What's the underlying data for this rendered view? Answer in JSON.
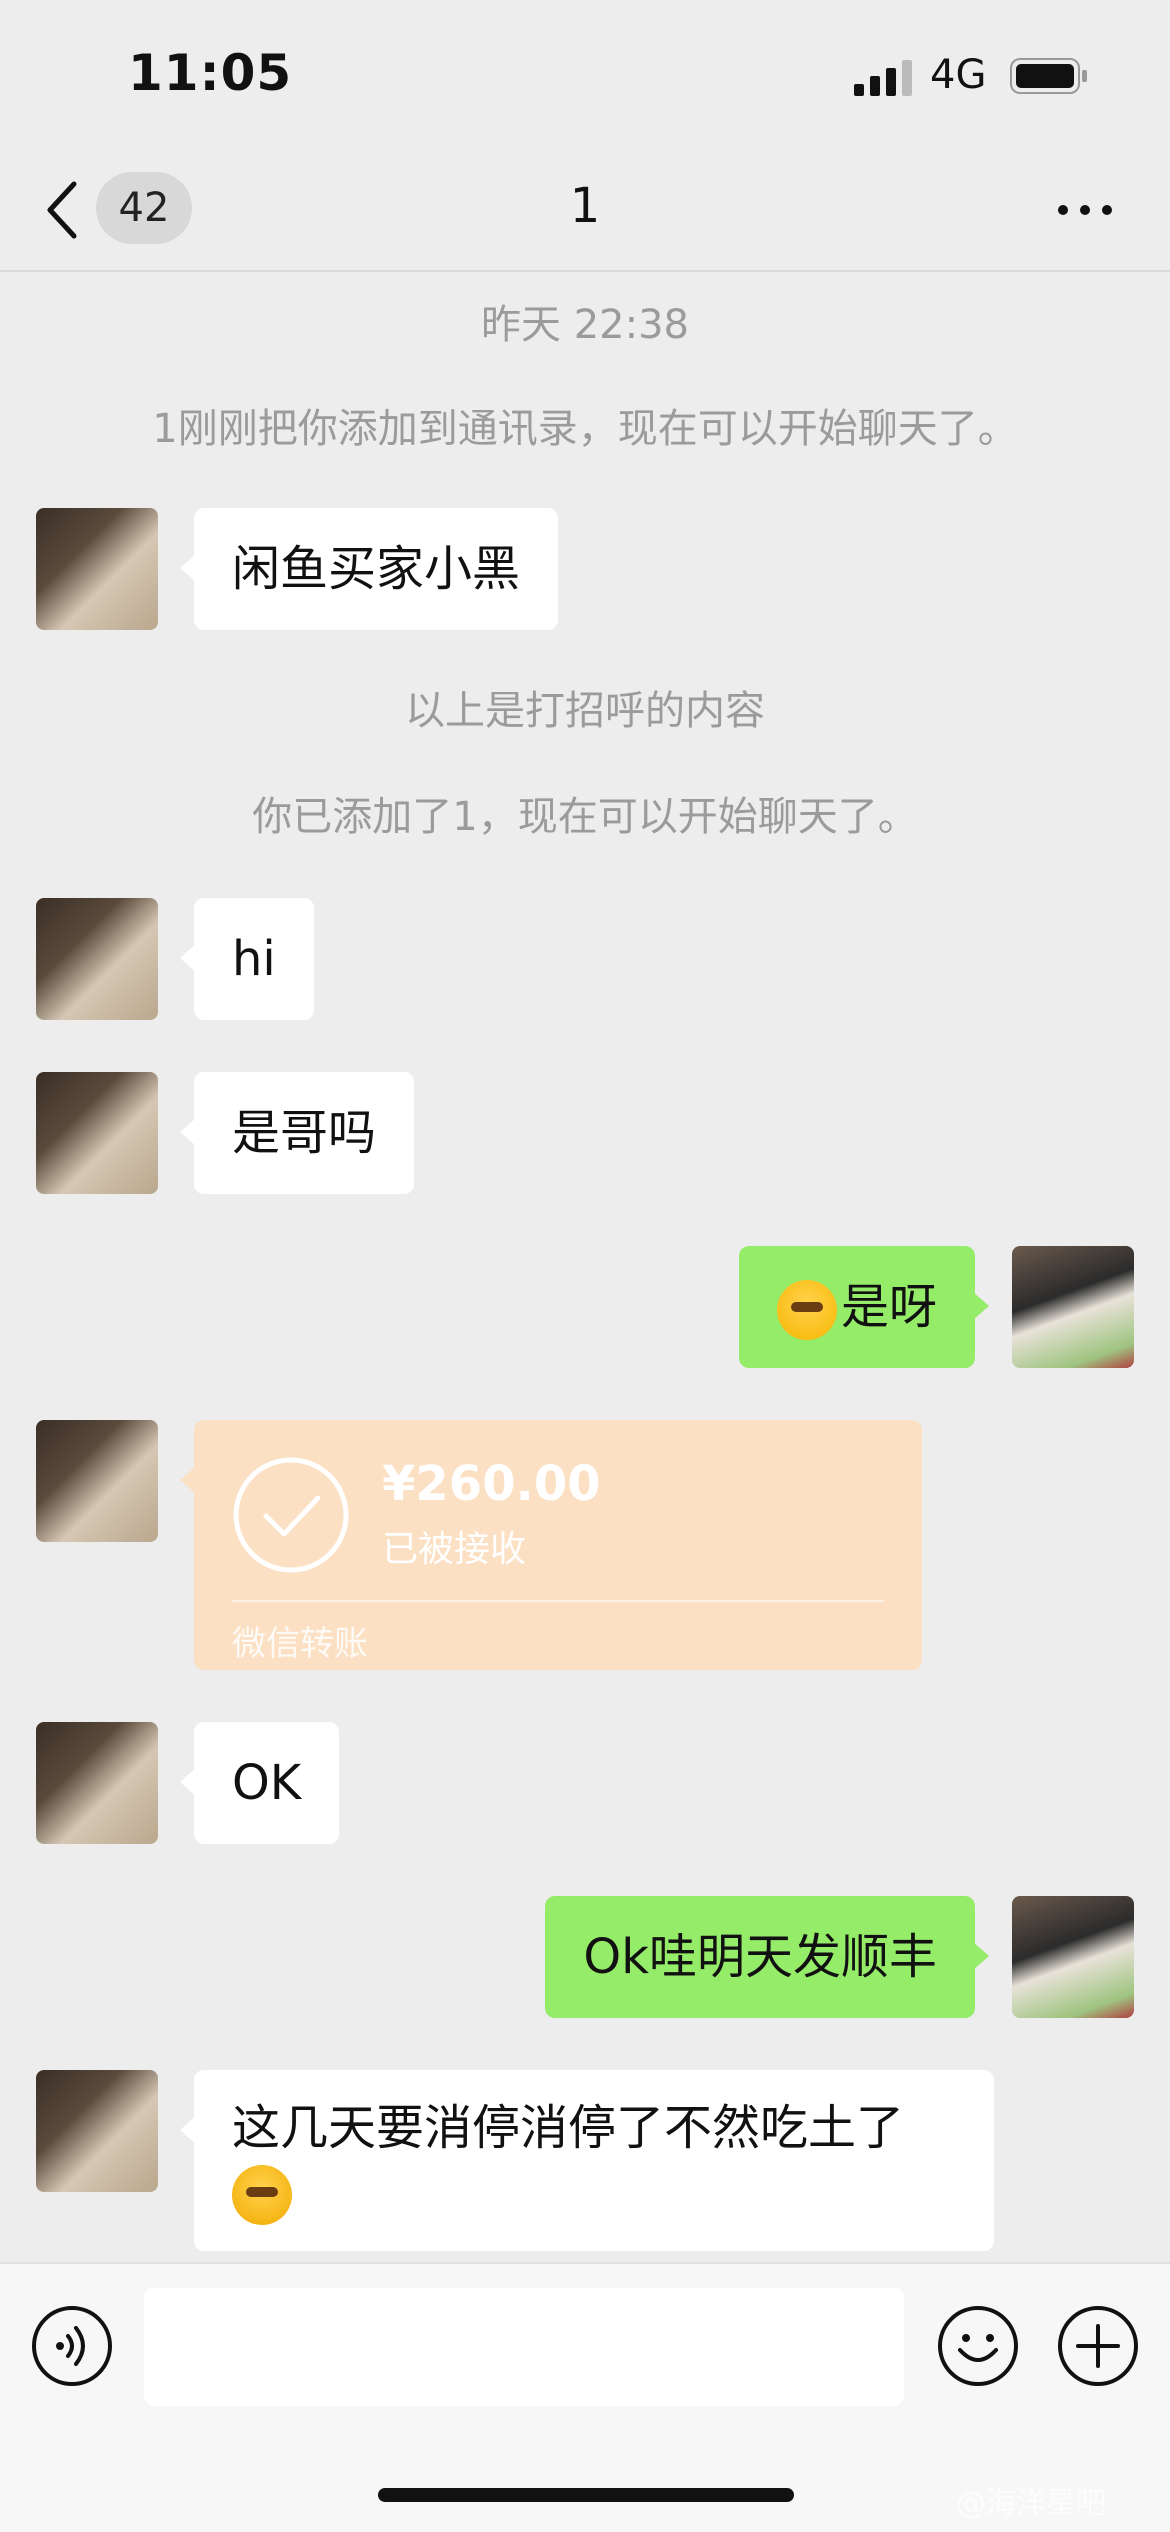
{
  "status_bar": {
    "time": "11:05",
    "network": "4G"
  },
  "nav": {
    "unread_count": "42",
    "title": "1"
  },
  "system": {
    "timestamp": "昨天 22:38",
    "added_notice": "1刚刚把你添加到通讯录，现在可以开始聊天了。",
    "greeting_notice": "以上是打招呼的内容",
    "you_added_notice": "你已添加了1，现在可以开始聊天了。"
  },
  "messages": [
    {
      "from": "contact",
      "text": "闲鱼买家小黑"
    },
    {
      "from": "contact",
      "text": "hi"
    },
    {
      "from": "contact",
      "text": "是哥吗"
    },
    {
      "from": "me",
      "emoji": "drooling-face-emoji",
      "text": "是呀"
    },
    {
      "from": "contact",
      "type": "transfer",
      "amount": "¥260.00",
      "status": "已被接收",
      "label": "微信转账"
    },
    {
      "from": "contact",
      "text": "OK"
    },
    {
      "from": "me",
      "text": "Ok哇明天发顺丰"
    },
    {
      "from": "contact",
      "text": "这几天要消停消停了不然吃土了",
      "emoji": "crying-face-emoji"
    }
  ],
  "input": {
    "placeholder": ""
  },
  "watermark": "@海洋星吧",
  "colors": {
    "background": "#ededed",
    "bubble_in": "#ffffff",
    "bubble_out": "#95ec69",
    "transfer_bg": "#fbe0c4",
    "system_text": "#9b9b9b"
  }
}
